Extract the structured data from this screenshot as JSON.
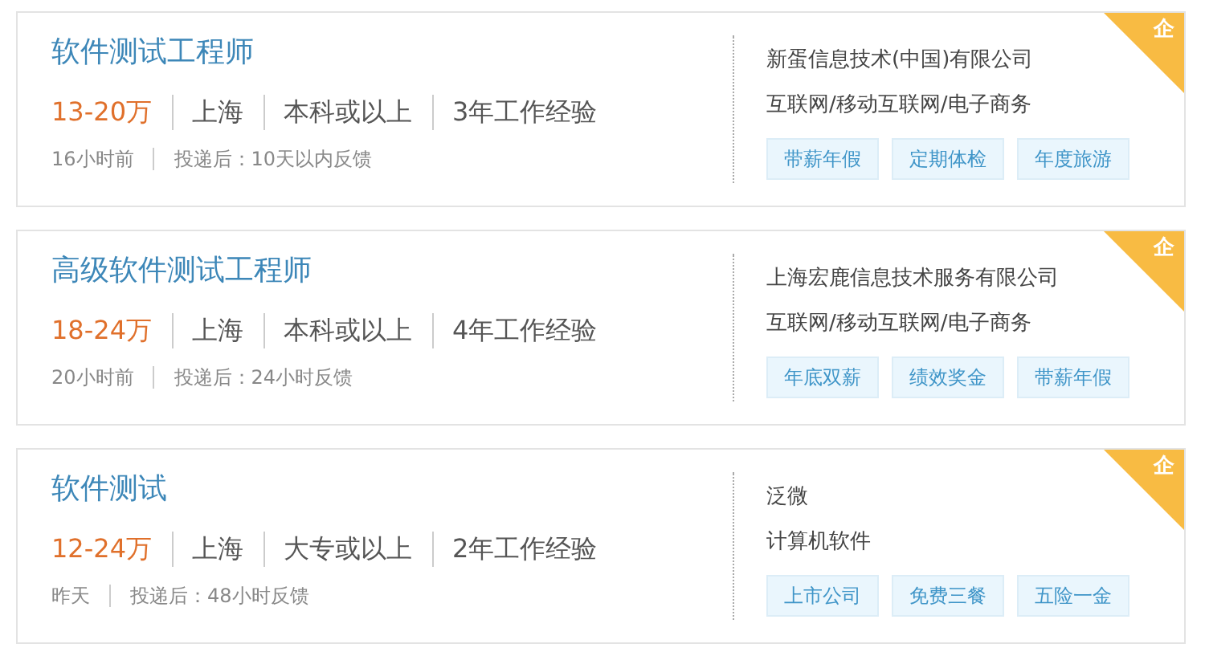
{
  "jobs": [
    {
      "title": "软件测试工程师",
      "salary": "13-20万",
      "city": "上海",
      "education": "本科或以上",
      "experience": "3年工作经验",
      "posted": "16小时前",
      "feedback": "投递后：10天以内反馈",
      "company": "新蛋信息技术(中国)有限公司",
      "industry": "互联网/移动互联网/电子商务",
      "tags": [
        "带薪年假",
        "定期体检",
        "年度旅游"
      ],
      "corner_label": "企"
    },
    {
      "title": "高级软件测试工程师",
      "salary": "18-24万",
      "city": "上海",
      "education": "本科或以上",
      "experience": "4年工作经验",
      "posted": "20小时前",
      "feedback": "投递后：24小时反馈",
      "company": "上海宏鹿信息技术服务有限公司",
      "industry": "互联网/移动互联网/电子商务",
      "tags": [
        "年底双薪",
        "绩效奖金",
        "带薪年假"
      ],
      "corner_label": "企"
    },
    {
      "title": "软件测试",
      "salary": "12-24万",
      "city": "上海",
      "education": "大专或以上",
      "experience": "2年工作经验",
      "posted": "昨天",
      "feedback": "投递后：48小时反馈",
      "company": "泛微",
      "industry": "计算机软件",
      "tags": [
        "上市公司",
        "免费三餐",
        "五险一金"
      ],
      "corner_label": "企"
    }
  ]
}
